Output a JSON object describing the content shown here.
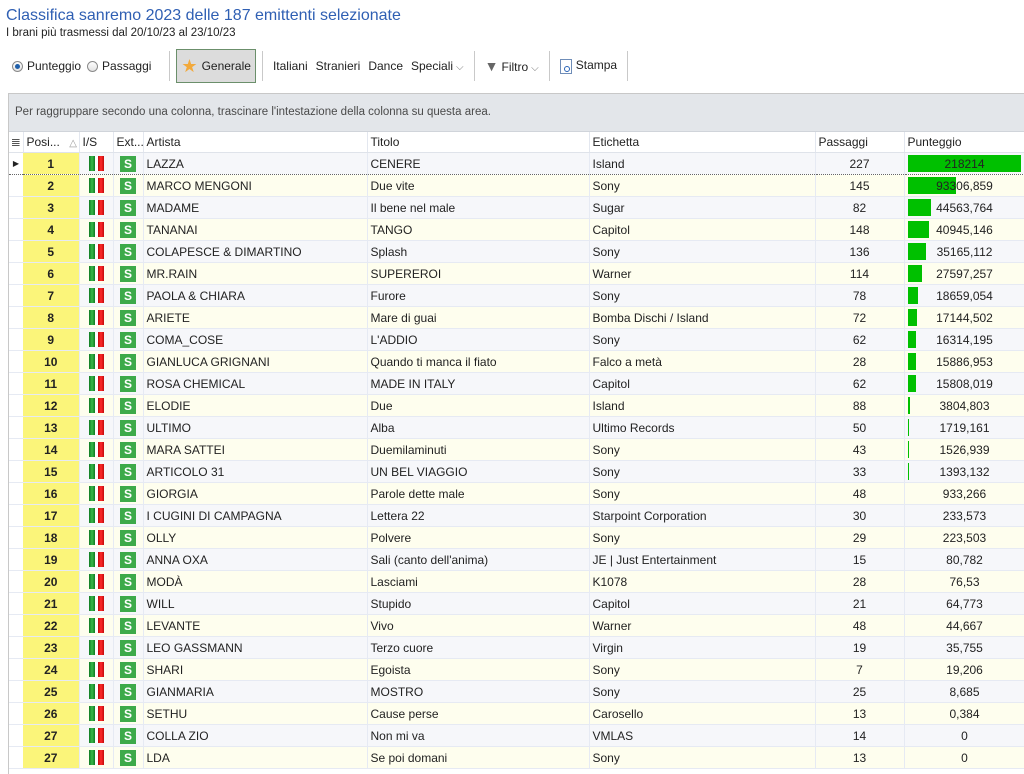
{
  "header": {
    "title": "Classifica sanremo 2023 delle 187 emittenti selezionate",
    "subtitle": "I brani più trasmessi dal 20/10/23 al 23/10/23"
  },
  "toolbar": {
    "radio_score": "Punteggio",
    "radio_passes": "Passaggi",
    "selected_radio": "Punteggio",
    "generale": "Generale",
    "italiani": "Italiani",
    "stranieri": "Stranieri",
    "dance": "Dance",
    "speciali": "Speciali",
    "filtro": "Filtro",
    "stampa": "Stampa"
  },
  "grid": {
    "group_hint": "Per raggruppare secondo una colonna, trascinare l'intestazione della colonna su questa area.",
    "columns": [
      "Posi...",
      "I/S",
      "Ext...",
      "Artista",
      "Titolo",
      "Etichetta",
      "Passaggi",
      "Punteggio"
    ],
    "sort_indicator": "△",
    "max_score": 218214,
    "accent_bar_color": "#00c000",
    "rows": [
      {
        "pos": "1",
        "ext": "S",
        "artist": "LAZZA",
        "title": "CENERE",
        "label": "Island",
        "passes": "227",
        "score": "218214",
        "score_value": 218214
      },
      {
        "pos": "2",
        "ext": "S",
        "artist": "MARCO MENGONI",
        "title": "Due vite",
        "label": "Sony",
        "passes": "145",
        "score": "93306,859",
        "score_value": 93306.859
      },
      {
        "pos": "3",
        "ext": "S",
        "artist": "MADAME",
        "title": "Il bene nel male",
        "label": "Sugar",
        "passes": "82",
        "score": "44563,764",
        "score_value": 44563.764
      },
      {
        "pos": "4",
        "ext": "S",
        "artist": "TANANAI",
        "title": "TANGO",
        "label": "Capitol",
        "passes": "148",
        "score": "40945,146",
        "score_value": 40945.146
      },
      {
        "pos": "5",
        "ext": "S",
        "artist": "COLAPESCE & DIMARTINO",
        "title": "Splash",
        "label": "Sony",
        "passes": "136",
        "score": "35165,112",
        "score_value": 35165.112
      },
      {
        "pos": "6",
        "ext": "S",
        "artist": "MR.RAIN",
        "title": "SUPEREROI",
        "label": "Warner",
        "passes": "114",
        "score": "27597,257",
        "score_value": 27597.257
      },
      {
        "pos": "7",
        "ext": "S",
        "artist": "PAOLA & CHIARA",
        "title": "Furore",
        "label": "Sony",
        "passes": "78",
        "score": "18659,054",
        "score_value": 18659.054
      },
      {
        "pos": "8",
        "ext": "S",
        "artist": "ARIETE",
        "title": "Mare di guai",
        "label": "Bomba Dischi / Island",
        "passes": "72",
        "score": "17144,502",
        "score_value": 17144.502
      },
      {
        "pos": "9",
        "ext": "S",
        "artist": "COMA_COSE",
        "title": "L'ADDIO",
        "label": "Sony",
        "passes": "62",
        "score": "16314,195",
        "score_value": 16314.195
      },
      {
        "pos": "10",
        "ext": "S",
        "artist": "GIANLUCA GRIGNANI",
        "title": "Quando ti manca il fiato",
        "label": "Falco a metà",
        "passes": "28",
        "score": "15886,953",
        "score_value": 15886.953
      },
      {
        "pos": "11",
        "ext": "S",
        "artist": "ROSA CHEMICAL",
        "title": "MADE IN ITALY",
        "label": "Capitol",
        "passes": "62",
        "score": "15808,019",
        "score_value": 15808.019
      },
      {
        "pos": "12",
        "ext": "S",
        "artist": "ELODIE",
        "title": "Due",
        "label": "Island",
        "passes": "88",
        "score": "3804,803",
        "score_value": 3804.803
      },
      {
        "pos": "13",
        "ext": "S",
        "artist": "ULTIMO",
        "title": "Alba",
        "label": "Ultimo Records",
        "passes": "50",
        "score": "1719,161",
        "score_value": 1719.161
      },
      {
        "pos": "14",
        "ext": "S",
        "artist": "MARA SATTEI",
        "title": "Duemilaminuti",
        "label": "Sony",
        "passes": "43",
        "score": "1526,939",
        "score_value": 1526.939
      },
      {
        "pos": "15",
        "ext": "S",
        "artist": "ARTICOLO 31",
        "title": "UN BEL VIAGGIO",
        "label": "Sony",
        "passes": "33",
        "score": "1393,132",
        "score_value": 1393.132
      },
      {
        "pos": "16",
        "ext": "S",
        "artist": "GIORGIA",
        "title": "Parole dette male",
        "label": "Sony",
        "passes": "48",
        "score": "933,266",
        "score_value": 933.266
      },
      {
        "pos": "17",
        "ext": "S",
        "artist": "I CUGINI DI CAMPAGNA",
        "title": "Lettera 22",
        "label": "Starpoint Corporation",
        "passes": "30",
        "score": "233,573",
        "score_value": 233.573
      },
      {
        "pos": "18",
        "ext": "S",
        "artist": "OLLY",
        "title": "Polvere",
        "label": "Sony",
        "passes": "29",
        "score": "223,503",
        "score_value": 223.503
      },
      {
        "pos": "19",
        "ext": "S",
        "artist": "ANNA OXA",
        "title": "Sali (canto dell'anima)",
        "label": "JE | Just Entertainment",
        "passes": "15",
        "score": "80,782",
        "score_value": 80.782
      },
      {
        "pos": "20",
        "ext": "S",
        "artist": "MODÀ",
        "title": "Lasciami",
        "label": "K1078",
        "passes": "28",
        "score": "76,53",
        "score_value": 76.53
      },
      {
        "pos": "21",
        "ext": "S",
        "artist": "WILL",
        "title": "Stupido",
        "label": "Capitol",
        "passes": "21",
        "score": "64,773",
        "score_value": 64.773
      },
      {
        "pos": "22",
        "ext": "S",
        "artist": "LEVANTE",
        "title": "Vivo",
        "label": "Warner",
        "passes": "48",
        "score": "44,667",
        "score_value": 44.667
      },
      {
        "pos": "23",
        "ext": "S",
        "artist": "LEO GASSMANN",
        "title": "Terzo cuore",
        "label": "Virgin",
        "passes": "19",
        "score": "35,755",
        "score_value": 35.755
      },
      {
        "pos": "24",
        "ext": "S",
        "artist": "SHARI",
        "title": "Egoista",
        "label": "Sony",
        "passes": "7",
        "score": "19,206",
        "score_value": 19.206
      },
      {
        "pos": "25",
        "ext": "S",
        "artist": "GIANMARIA",
        "title": "MOSTRO",
        "label": "Sony",
        "passes": "25",
        "score": "8,685",
        "score_value": 8.685
      },
      {
        "pos": "26",
        "ext": "S",
        "artist": "SETHU",
        "title": "Cause perse",
        "label": "Carosello",
        "passes": "13",
        "score": "0,384",
        "score_value": 0.384
      },
      {
        "pos": "27",
        "ext": "S",
        "artist": "COLLA ZIO",
        "title": "Non mi va",
        "label": "VMLAS",
        "passes": "14",
        "score": "0",
        "score_value": 0
      },
      {
        "pos": "27",
        "ext": "S",
        "artist": "LDA",
        "title": "Se poi domani",
        "label": "Sony",
        "passes": "13",
        "score": "0",
        "score_value": 0
      }
    ]
  }
}
